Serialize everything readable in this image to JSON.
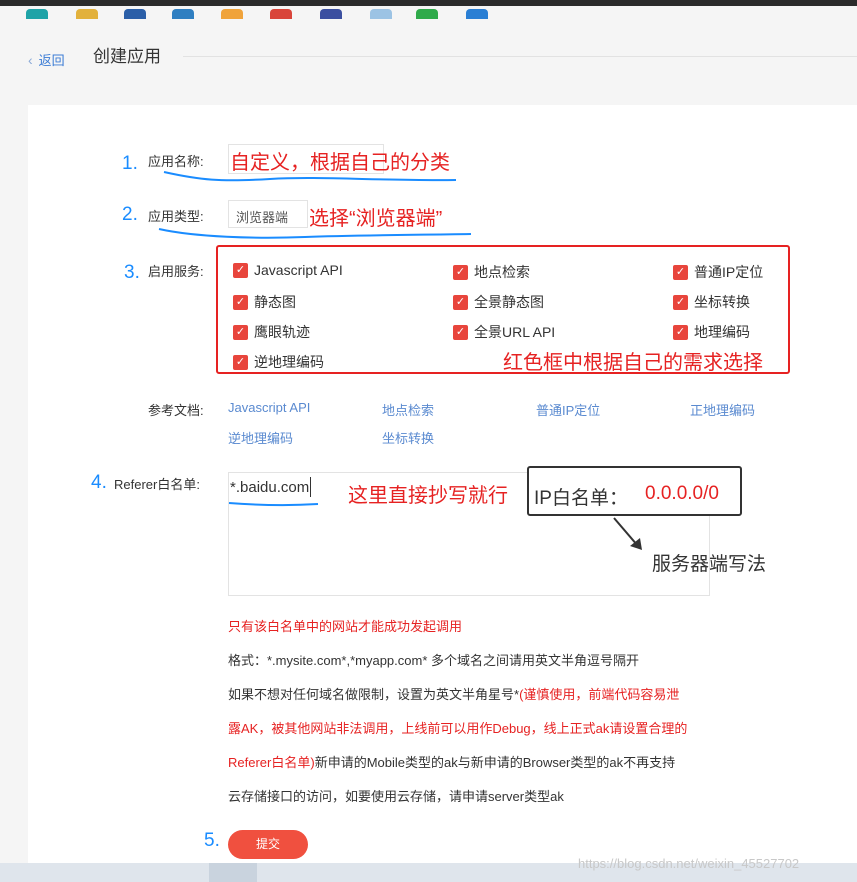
{
  "header": {
    "back_label": "返回",
    "title": "创建应用"
  },
  "steps": [
    "1.",
    "2.",
    "3.",
    "4.",
    "5."
  ],
  "form": {
    "app_name_label": "应用名称:",
    "app_type_label": "应用类型:",
    "app_type_value": "浏览器端",
    "services_label": "启用服务:",
    "docs_label": "参考文档:",
    "referer_label": "Referer白名单:",
    "referer_value": "*.baidu.com",
    "submit_label": "提交"
  },
  "services": [
    "Javascript API",
    "地点检索",
    "普通IP定位",
    "静态图",
    "全景静态图",
    "坐标转换",
    "鹰眼轨迹",
    "全景URL API",
    "地理编码",
    "逆地理编码"
  ],
  "docs": [
    "Javascript API",
    "地点检索",
    "普通IP定位",
    "正地理编码",
    "逆地理编码",
    "坐标转换"
  ],
  "annotations": {
    "name_hint": "自定义，根据自己的分类",
    "type_hint": "选择“浏览器端”",
    "services_hint": "红色框中根据自己的需求选择",
    "referer_hint": "这里直接抄写就行",
    "ip_label": "IP白名单：",
    "ip_value": "0.0.0.0/0",
    "server_note": "服务器端写法"
  },
  "help": {
    "warning": "只有该白名单中的网站才能成功发起调用",
    "format": "格式：*.mysite.com*,*myapp.com* 多个域名之间请用英文半角逗号隔开",
    "line3_a": "如果不想对任何域名做限制，设置为英文半角星号*",
    "line3_b": "(谨慎使用，前端代码容易泄",
    "line4": "露AK，被其他网站非法调用，上线前可以用作Debug，线上正式ak请设置合理的",
    "line5_a": "Referer白名单)",
    "line5_b": "新申请的Mobile类型的ak与新申请的Browser类型的ak不再支持",
    "line6": "云存储接口的访问，如要使用云存储，请申请server类型ak"
  },
  "watermark": "https://blog.csdn.net/weixin_45527702",
  "colors": {
    "accent_blue": "#1a8cff",
    "annotation_red": "#e62222",
    "submit": "#f0503f",
    "checkbox": "#e8453c"
  },
  "icons": [
    "chevron-left-icon",
    "checkbox-checked-icon",
    "arrow-pointer-icon"
  ]
}
